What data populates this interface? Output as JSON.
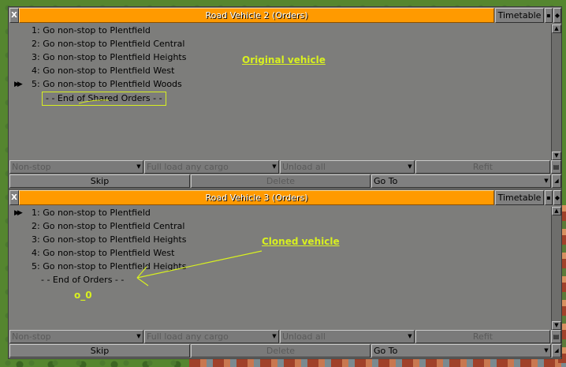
{
  "windows": [
    {
      "title": "Road Vehicle 2 (Orders)",
      "timetable_label": "Timetable",
      "close_glyph": "X",
      "orders": [
        "1: Go non-stop to Plentfield",
        "2: Go non-stop to Plentfield Central",
        "3: Go non-stop to Plentfield Heights",
        "4: Go non-stop to Plentfield West",
        "5: Go non-stop to Plentfield Woods"
      ],
      "current_order_index": 4,
      "end_label": "- - End of Shared Orders - -",
      "nonstop_label": "Non-stop",
      "full_load_label": "Full load any cargo",
      "unload_label": "Unload all",
      "refit_label": "Refit",
      "skip_label": "Skip",
      "delete_label": "Delete",
      "goto_label": "Go To"
    },
    {
      "title": "Road Vehicle 3 (Orders)",
      "timetable_label": "Timetable",
      "close_glyph": "X",
      "orders": [
        "1: Go non-stop to Plentfield",
        "2: Go non-stop to Plentfield Central",
        "3: Go non-stop to Plentfield Heights",
        "4: Go non-stop to Plentfield West",
        "5: Go non-stop to Plentfield Heights"
      ],
      "current_order_index": 0,
      "end_label": "- - End of Orders - -",
      "nonstop_label": "Non-stop",
      "full_load_label": "Full load any cargo",
      "unload_label": "Unload all",
      "refit_label": "Refit",
      "skip_label": "Skip",
      "delete_label": "Delete",
      "goto_label": "Go To"
    }
  ],
  "annotations": {
    "original": "Original vehicle",
    "cloned": "Cloned vehicle",
    "face": "o_0"
  },
  "icons": {
    "current_order": "double-triangle-icon",
    "close": "close-icon",
    "dropdown": "triangle-down-icon"
  },
  "colors": {
    "title_bar": "#ff9a00",
    "window_bg": "#7d7d7b",
    "annotation": "#d8f020"
  }
}
